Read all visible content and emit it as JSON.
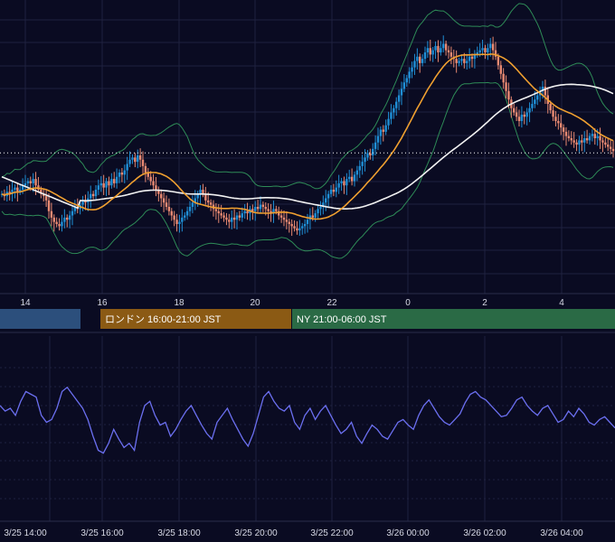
{
  "colors": {
    "background": "#0a0b22",
    "grid": "#1f2240",
    "candle_up": "#1f8fd6",
    "candle_down": "#e98a72",
    "ma_short": "#f0a030",
    "ma_long": "#f2f2f2",
    "bollinger": "#2e8b57",
    "rsi_line": "#6b6ff0",
    "session_tokyo": "#2c4f7c",
    "session_london": "#8b5a14",
    "session_ny": "#2a6a45"
  },
  "main_chart": {
    "x_ticks": [
      "14",
      "16",
      "18",
      "20",
      "22",
      "0",
      "2",
      "4"
    ],
    "sessions": [
      {
        "name": "tokyo",
        "label": ""
      },
      {
        "name": "london",
        "label": "ロンドン 16:00-21:00 JST"
      },
      {
        "name": "ny",
        "label": "NY 21:00-06:00 JST"
      }
    ]
  },
  "oscillator": {
    "x_ticks": [
      "3/25 14:00",
      "3/25 16:00",
      "3/25 18:00",
      "3/25 20:00",
      "3/25 22:00",
      "3/26 00:00",
      "3/26 02:00",
      "3/26 04:00"
    ]
  },
  "chart_data": [
    {
      "type": "candlestick",
      "x_range": [
        "3/25 13:10",
        "3/26 05:35"
      ],
      "x_ticks": [
        "14",
        "16",
        "18",
        "20",
        "22",
        "0",
        "2",
        "4"
      ],
      "close": [
        58,
        57,
        59,
        58,
        60,
        61,
        59,
        60,
        62,
        63,
        64,
        63,
        65,
        62,
        60,
        58,
        57,
        55,
        50,
        47,
        45,
        44,
        43,
        45,
        47,
        46,
        48,
        50,
        52,
        51,
        53,
        55,
        54,
        56,
        58,
        57,
        60,
        62,
        63,
        61,
        64,
        62,
        65,
        63,
        66,
        68,
        67,
        69,
        72,
        74,
        75,
        73,
        76,
        74,
        71,
        68,
        66,
        64,
        62,
        60,
        58,
        56,
        54,
        52,
        50,
        48,
        46,
        44,
        45,
        47,
        48,
        50,
        52,
        54,
        56,
        58,
        60,
        58,
        55,
        54,
        53,
        51,
        50,
        49,
        48,
        47,
        46,
        45,
        47,
        46,
        48,
        47,
        49,
        50,
        49,
        51,
        50,
        52,
        51,
        53,
        52,
        51,
        50,
        49,
        51,
        50,
        48,
        47,
        46,
        45,
        44,
        43,
        42,
        41,
        42,
        43,
        44,
        46,
        48,
        47,
        49,
        51,
        52,
        54,
        56,
        58,
        60,
        59,
        61,
        63,
        64,
        62,
        65,
        66,
        64,
        67,
        69,
        71,
        73,
        75,
        77,
        76,
        79,
        82,
        85,
        88,
        87,
        90,
        93,
        96,
        98,
        101,
        104,
        107,
        110,
        112,
        115,
        117,
        120,
        122,
        119,
        121,
        124,
        126,
        123,
        125,
        127,
        124,
        126,
        128,
        125,
        124,
        122,
        121,
        119,
        120,
        121,
        119,
        120,
        122,
        121,
        123,
        124,
        125,
        126,
        124,
        126,
        128,
        125,
        122,
        118,
        114,
        110,
        106,
        102,
        98,
        96,
        94,
        92,
        95,
        94,
        96,
        98,
        100,
        102,
        104,
        106,
        108,
        104,
        100,
        97,
        94,
        92,
        91,
        89,
        87,
        85,
        84,
        83,
        82,
        81,
        83,
        82,
        84,
        83,
        85,
        86,
        84,
        85,
        83,
        82,
        81,
        80,
        79,
        78
      ],
      "ma_short": "orange",
      "ma_long": "white",
      "bollinger": true
    },
    {
      "type": "line",
      "name": "",
      "x_ticks": [
        "3/25 14:00",
        "3/25 16:00",
        "3/25 18:00",
        "3/25 20:00",
        "3/25 22:00",
        "3/26 00:00",
        "3/26 02:00",
        "3/26 04:00"
      ],
      "values": [
        62,
        58,
        60,
        55,
        65,
        72,
        70,
        68,
        55,
        50,
        52,
        60,
        72,
        75,
        70,
        65,
        60,
        52,
        40,
        30,
        28,
        35,
        45,
        38,
        32,
        35,
        30,
        50,
        62,
        65,
        55,
        48,
        50,
        40,
        45,
        52,
        58,
        62,
        55,
        48,
        42,
        38,
        50,
        55,
        60,
        52,
        45,
        38,
        33,
        42,
        55,
        68,
        72,
        65,
        60,
        58,
        62,
        50,
        45,
        55,
        60,
        52,
        58,
        62,
        55,
        48,
        42,
        45,
        50,
        40,
        35,
        42,
        48,
        45,
        40,
        38,
        44,
        50,
        52,
        48,
        45,
        55,
        62,
        66,
        60,
        54,
        50,
        48,
        52,
        56,
        64,
        70,
        72,
        68,
        66,
        62,
        58,
        54,
        55,
        60,
        66,
        68,
        62,
        58,
        55,
        60,
        62,
        56,
        50,
        52,
        58,
        54,
        60,
        56,
        50,
        48,
        52,
        54,
        50,
        46
      ],
      "ylim": [
        0,
        100
      ],
      "grid": true
    }
  ]
}
